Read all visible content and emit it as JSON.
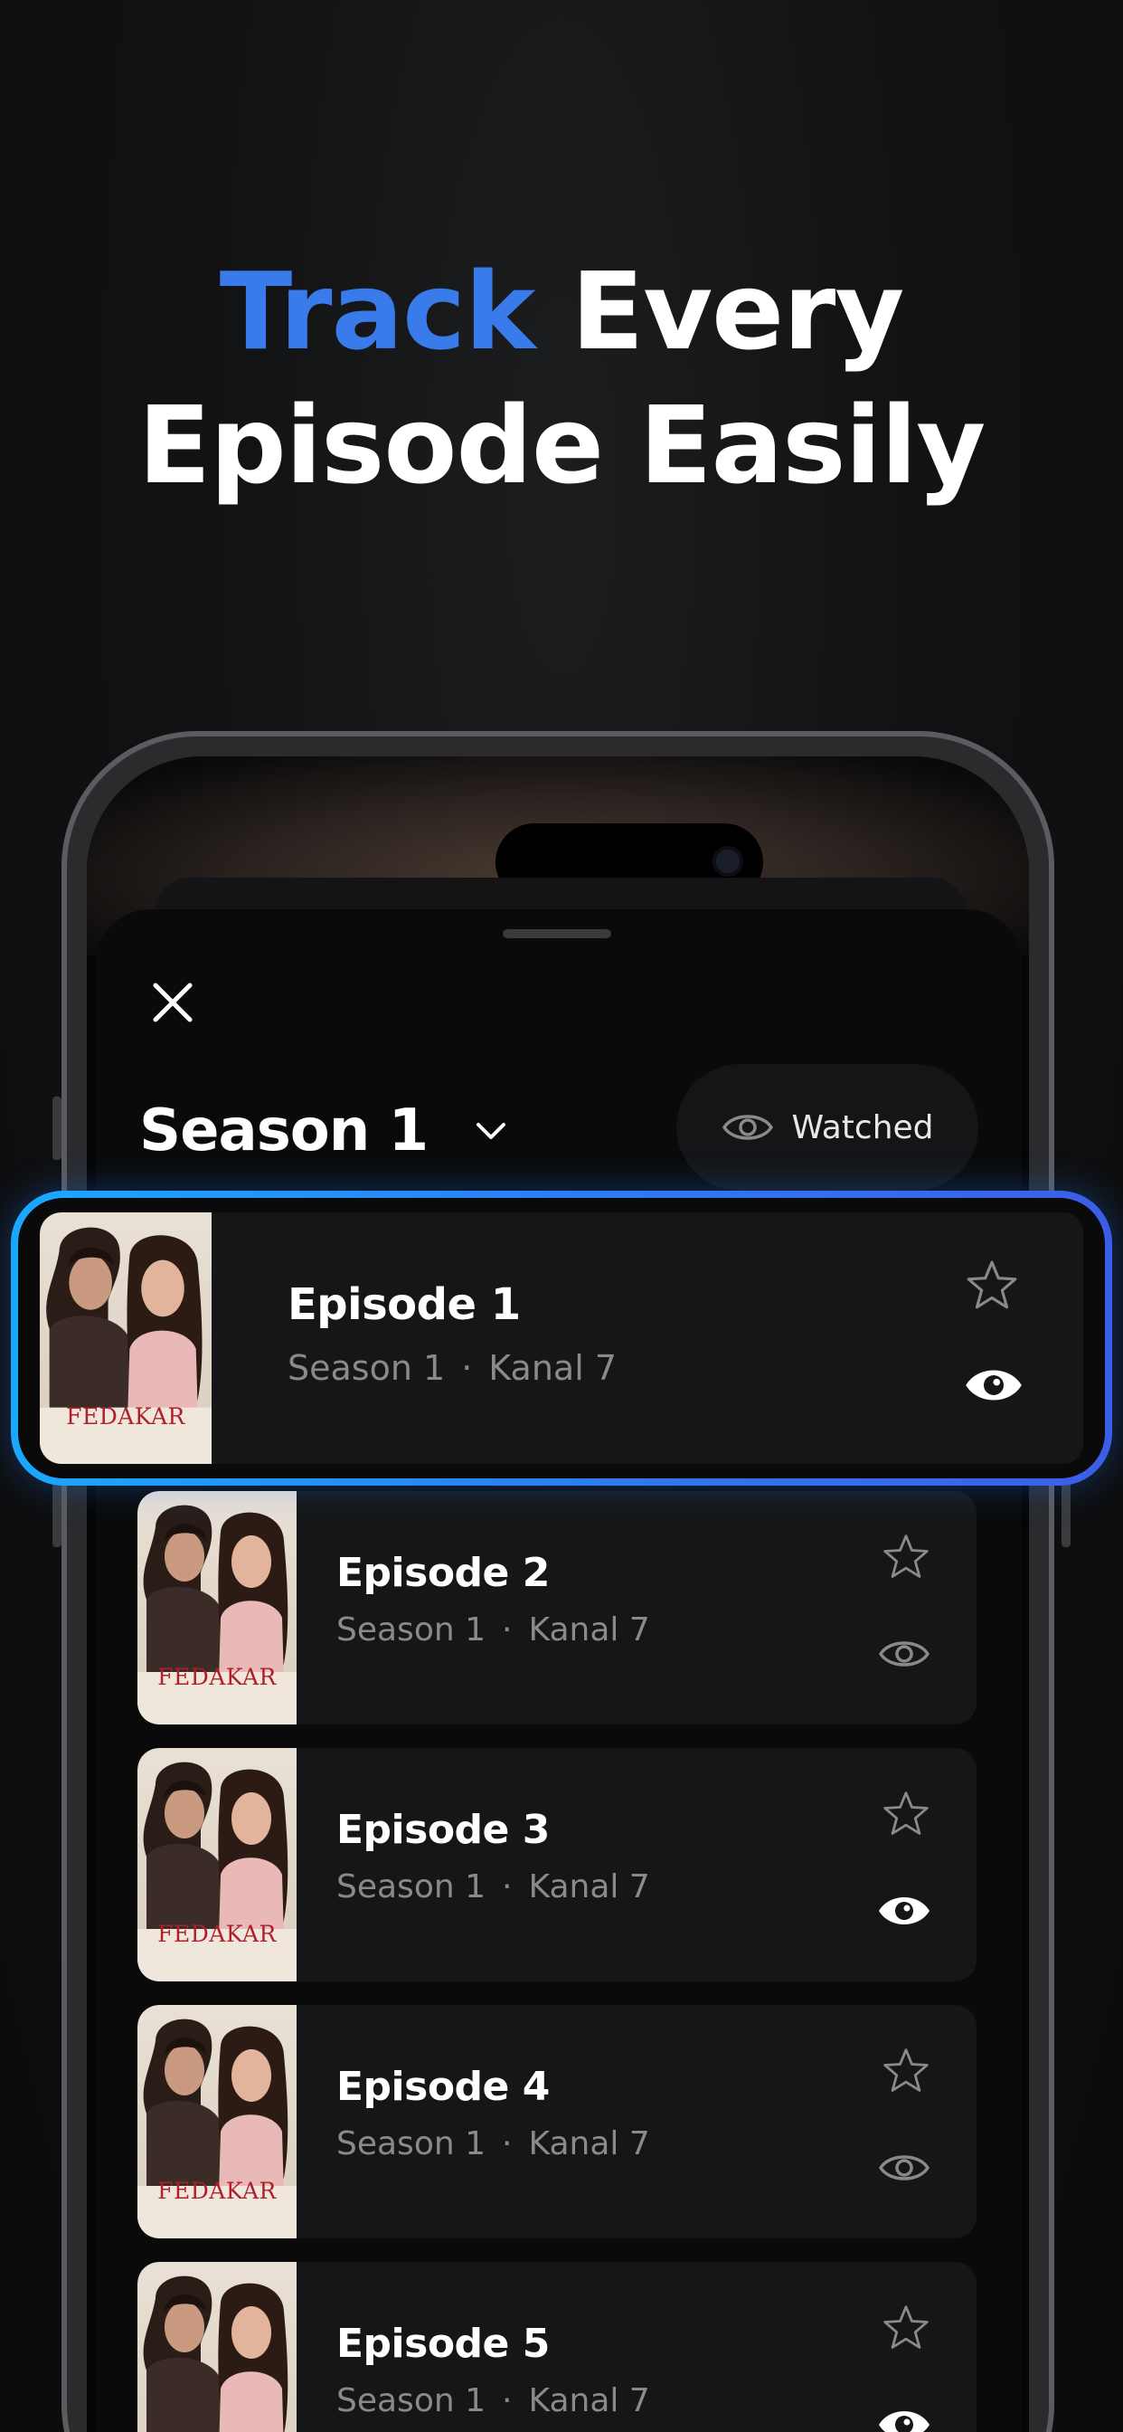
{
  "headline": {
    "accent": "Track",
    "rest_line1": " Every",
    "line2": "Episode Easily"
  },
  "sheet": {
    "close_icon": "close-icon",
    "season_label": "Season 1",
    "season_chevron_icon": "chevron-down-icon",
    "watched_filter_label": "Watched",
    "watched_filter_icon": "eye-icon"
  },
  "poster_text": "FEDAKAR",
  "episodes": [
    {
      "title": "Episode 1",
      "season": "Season 1",
      "channel": "Kanal 7",
      "watched": true,
      "favorite": false,
      "highlighted": true
    },
    {
      "title": "Episode 2",
      "season": "Season 1",
      "channel": "Kanal 7",
      "watched": false,
      "favorite": false
    },
    {
      "title": "Episode 3",
      "season": "Season 1",
      "channel": "Kanal 7",
      "watched": true,
      "favorite": false
    },
    {
      "title": "Episode 4",
      "season": "Season 1",
      "channel": "Kanal 7",
      "watched": false,
      "favorite": false
    },
    {
      "title": "Episode 5",
      "season": "Season 1",
      "channel": "Kanal 7",
      "watched": true,
      "favorite": false
    }
  ],
  "sub_separator": "·",
  "colors": {
    "accent": "#3a7bec",
    "highlight_gradient_start": "#1aa8ff",
    "highlight_gradient_end": "#3b5ee8",
    "card_bg": "#151617"
  }
}
